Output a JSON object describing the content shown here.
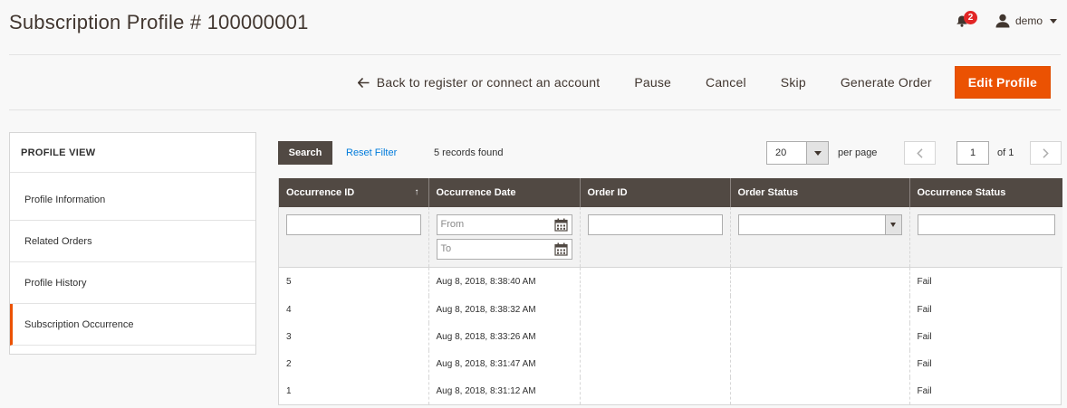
{
  "header": {
    "title": "Subscription Profile # 100000001",
    "notifications_count": "2",
    "user_name": "demo"
  },
  "actions": {
    "back_label": "Back to register or connect an account",
    "pause_label": "Pause",
    "cancel_label": "Cancel",
    "skip_label": "Skip",
    "generate_label": "Generate Order",
    "edit_label": "Edit Profile"
  },
  "sidebar": {
    "title": "PROFILE VIEW",
    "items": [
      {
        "label": "Profile Information"
      },
      {
        "label": "Related Orders"
      },
      {
        "label": "Profile History"
      },
      {
        "label": "Subscription Occurrence"
      }
    ]
  },
  "grid_toolbar": {
    "search_label": "Search",
    "reset_label": "Reset Filter",
    "records_found": "5 records found",
    "per_page_value": "20",
    "per_page_label": "per page",
    "current_page": "1",
    "of_pages": "of 1"
  },
  "table": {
    "columns": [
      "Occurrence ID",
      "Occurrence Date",
      "Order ID",
      "Order Status",
      "Occurrence Status"
    ],
    "filters": {
      "from_placeholder": "From",
      "to_placeholder": "To"
    },
    "rows": [
      {
        "id": "5",
        "date": "Aug 8, 2018, 8:38:40 AM",
        "order_id": "",
        "order_status": "",
        "status": "Fail"
      },
      {
        "id": "4",
        "date": "Aug 8, 2018, 8:38:32 AM",
        "order_id": "",
        "order_status": "",
        "status": "Fail"
      },
      {
        "id": "3",
        "date": "Aug 8, 2018, 8:33:26 AM",
        "order_id": "",
        "order_status": "",
        "status": "Fail"
      },
      {
        "id": "2",
        "date": "Aug 8, 2018, 8:31:47 AM",
        "order_id": "",
        "order_status": "",
        "status": "Fail"
      },
      {
        "id": "1",
        "date": "Aug 8, 2018, 8:31:12 AM",
        "order_id": "",
        "order_status": "",
        "status": "Fail"
      }
    ]
  },
  "colors": {
    "accent": "#eb5202",
    "header_bg": "#514943",
    "link": "#007bdb",
    "badge": "#e22626"
  }
}
